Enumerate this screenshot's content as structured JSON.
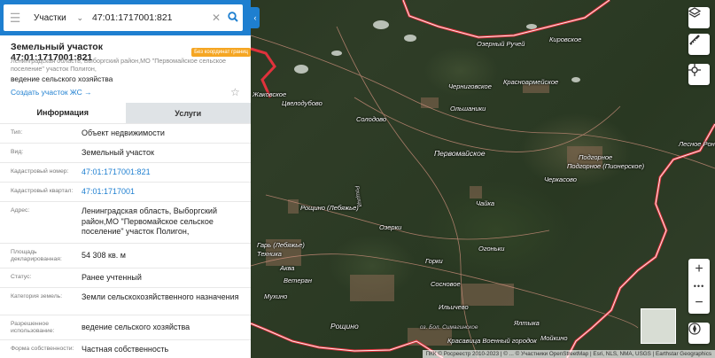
{
  "search": {
    "type_label": "Участки",
    "query": "47:01:1717001:821"
  },
  "parcel": {
    "title": "Земельный участок 47:01:1717001:821",
    "badge": "Без координат границ",
    "address_small": "Ленинградская область, Выборгский район,МО \"Первомайское сельское поселение\" участок Полигон,",
    "usage": "ведение сельского хозяйства",
    "create_link": "Создать участок ЖС →"
  },
  "tabs": [
    {
      "label": "Информация"
    },
    {
      "label": "Услуги"
    }
  ],
  "fields": [
    {
      "key": "Тип:",
      "value": "Объект недвижимости"
    },
    {
      "key": "Вид:",
      "value": "Земельный участок"
    },
    {
      "key": "Кадастровый номер:",
      "value": "47:01:1717001:821"
    },
    {
      "key": "Кадастровый квартал:",
      "value": "47:01:1717001"
    },
    {
      "key": "Адрес:",
      "value": "Ленинградская область, Выборгский район,МО \"Первомайское сельское поселение\" участок Полигон,"
    },
    {
      "key": "Площадь декларированная:",
      "value": "54 308 кв. м"
    },
    {
      "key": "Статус:",
      "value": "Ранее учтенный"
    },
    {
      "key": "Категория земель:",
      "value": "Земли сельскохозяйственного назначения"
    },
    {
      "key": "Разрешенное использование:",
      "value": "ведение сельского хозяйства"
    },
    {
      "key": "Форма собственности:",
      "value": "Частная собственность"
    }
  ],
  "map_labels": [
    "Озерный Ручей",
    "Кировское",
    "Черниговское",
    "Красноармейское",
    "Жаковское",
    "Цвелодубово",
    "Ольшаники",
    "Солодово",
    "Первомайское",
    "Подгорное",
    "Подгорное (Пионерское)",
    "Лесное Ронино",
    "Черкасово",
    "Рощино (Лебяжье)",
    "Рощица",
    "Озерки",
    "Чайка",
    "Гарь (Лебяжье)",
    "Техника",
    "Аква",
    "Ветеран",
    "Мухино",
    "Горки",
    "Огоньки",
    "Сосновое",
    "Ильичево",
    "оз. Бол. Симагинское",
    "Ялтыка",
    "Рощино",
    "Красавица Военный городок",
    "Мойкино"
  ],
  "attribution": "ПКК © Росреестр 2010-2023 | © ... © Участники OpenStreetMap | Esri, NLS, NMA, USGS | Earthstar Geographics"
}
